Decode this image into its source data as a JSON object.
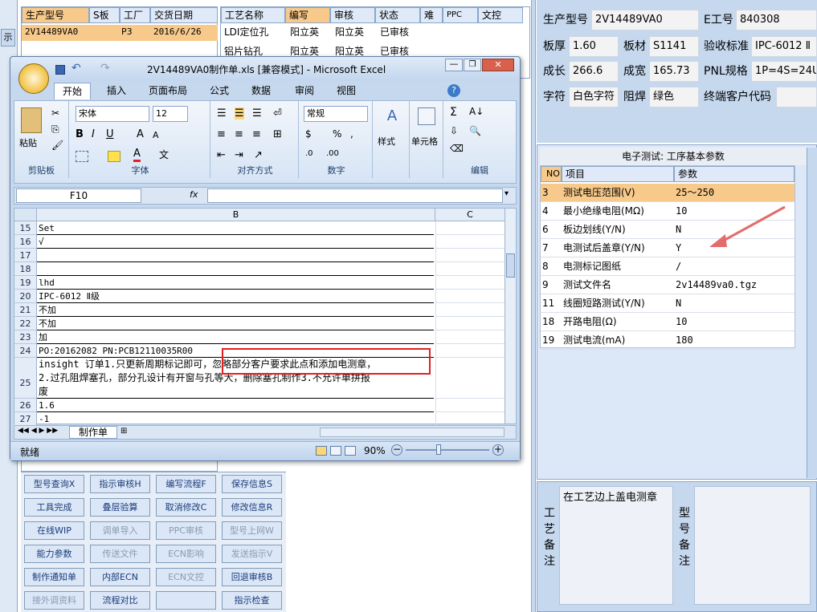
{
  "left_table": {
    "headers": [
      "生产型号",
      "S板",
      "工厂",
      "交货日期"
    ],
    "row": {
      "model": "2V14489VA0",
      "factory": "P3",
      "date": "2016/6/26"
    }
  },
  "left_edge_label": "示",
  "process_table": {
    "headers": [
      "工艺名称",
      "编写",
      "审核",
      "状态",
      "难",
      "PPC",
      "文控"
    ],
    "rows": [
      [
        "LDI定位孔",
        "阳立英",
        "阳立英",
        "已审核"
      ],
      [
        "铝片钻孔",
        "阳立英",
        "阳立英",
        "已审核"
      ]
    ]
  },
  "excel": {
    "title": "2V14489VA0制作单.xls  [兼容模式] - Microsoft Excel",
    "tabs": [
      "开始",
      "插入",
      "页面布局",
      "公式",
      "数据",
      "审阅",
      "视图"
    ],
    "clipboard": {
      "paste": "粘贴",
      "group": "剪贴板"
    },
    "font": {
      "name": "宋体",
      "size": "12",
      "group": "字体"
    },
    "align_group": "对齐方式",
    "number": {
      "format": "常规",
      "group": "数字"
    },
    "styles": "样式",
    "cells": "单元格",
    "edit_group": "编辑",
    "name_box": "F10",
    "fx": "fx",
    "col_b": "B",
    "col_c": "C",
    "rows": [
      {
        "n": "15",
        "t": "Set"
      },
      {
        "n": "16",
        "t": "√"
      },
      {
        "n": "17",
        "t": ""
      },
      {
        "n": "18",
        "t": ""
      },
      {
        "n": "19",
        "t": "lhd"
      },
      {
        "n": "20",
        "t": "IPC-6012 Ⅱ级"
      },
      {
        "n": "21",
        "t": "不加"
      },
      {
        "n": "22",
        "t": "不加"
      },
      {
        "n": "23",
        "t": "加"
      },
      {
        "n": "24",
        "t": "PO:20162082 PN:PCB12110035R00"
      },
      {
        "n": "25",
        "t1": "insight 订单1.只更新周期标记即可，忽略部分客户要求此点和添加电测章，",
        "t2": "2.过孔阻焊塞孔，部分孔设计有开窗与孔等大，删除塞孔制作3.不允许单拼报",
        "t3": "废"
      },
      {
        "n": "26",
        "t": "1.6"
      },
      {
        "n": "27",
        "t": "-1"
      }
    ],
    "sheet_tab": "制作单",
    "status": "就绪",
    "zoom": "90%"
  },
  "buttons": [
    [
      "型号查询X",
      "指示审核H",
      "编写流程F",
      "保存信息S"
    ],
    [
      "工具完成",
      "叠层验算",
      "取消修改C",
      "修改信息R"
    ],
    [
      "在线WIP",
      "调单导入",
      "PPC审核",
      "型号上网W"
    ],
    [
      "能力参数",
      "传送文件",
      "ECN影响",
      "发送指示V"
    ],
    [
      "制作通知单",
      "内部ECN",
      "ECN文控",
      "回退审核B"
    ],
    [
      "接外调资料",
      "流程对比",
      "",
      "指示检查"
    ]
  ],
  "disabled_buttons": [
    "调单导入",
    "PPC审核",
    "型号上网W",
    "传送文件",
    "ECN影响",
    "发送指示V",
    "ECN文控",
    "接外调资料"
  ],
  "info": {
    "model_label": "生产型号",
    "model": "2V14489VA0",
    "e_label": "E工号",
    "e_val": "840308",
    "thick_label": "板厚",
    "thick": "1.60",
    "mat_label": "板材",
    "mat": "S1141",
    "std_label": "验收标准",
    "std": "IPC-6012 Ⅱ",
    "len_label": "成长",
    "len": "266.6",
    "wid_label": "成宽",
    "wid": "165.73",
    "pnl_label": "PNL规格",
    "pnl": "1P=4S=24U",
    "char_label": "字符",
    "char": "白色字符",
    "mask_label": "阻焊",
    "mask": "绿色",
    "cust_label": "终端客户代码",
    "cust": ""
  },
  "params": {
    "title": "电子测试: 工序基本参数",
    "headers": [
      "NO",
      "项目",
      "参数"
    ],
    "rows": [
      [
        "3",
        "测试电压范围(V)",
        "25～250"
      ],
      [
        "4",
        "最小绝缘电阻(MΩ)",
        "10"
      ],
      [
        "6",
        "板边划线(Y/N)",
        "N"
      ],
      [
        "7",
        "电测试后盖章(Y/N)",
        "Y"
      ],
      [
        "8",
        "电测标记图纸",
        "/"
      ],
      [
        "9",
        "测试文件名",
        "2v14489va0.tgz"
      ],
      [
        "11",
        "线圈短路测试(Y/N)",
        "N"
      ],
      [
        "18",
        "开路电阻(Ω)",
        "10"
      ],
      [
        "19",
        "测试电流(mA)",
        "180"
      ]
    ]
  },
  "remarks": {
    "craft_label": "工艺备注",
    "craft_text": "在工艺边上盖电测章",
    "model_label": "型号备注"
  },
  "colors": {
    "accent_orange": "#f7c98a",
    "highlight_box": "#e02020",
    "arrow": "#e36c6c",
    "app_bg": "#c5d8ee"
  }
}
